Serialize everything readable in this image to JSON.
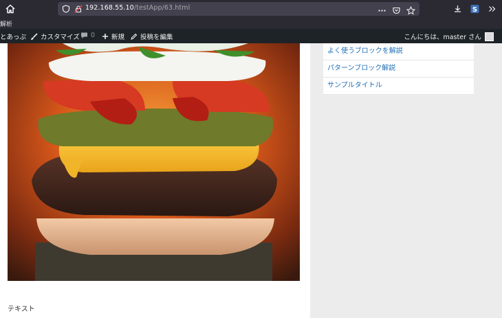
{
  "browser": {
    "url_host": "192.168.55.10",
    "url_path": "/testApp/63.html"
  },
  "bookmarks": {
    "label": "解析"
  },
  "adminbar": {
    "site_label": "とあっぷ",
    "customize_label": "カスタマイズ",
    "comments_count": "0",
    "new_label": "新規",
    "edit_label": "投稿を編集",
    "greeting": "こんにちは、master さん"
  },
  "sidebar": {
    "links": [
      {
        "label": "よく使うブロックを解説"
      },
      {
        "label": "パターンブロック解説"
      },
      {
        "label": "サンプルタイトル"
      }
    ]
  },
  "content": {
    "text": "テキスト",
    "image_alt": "hamburger photo"
  },
  "colors": {
    "browser_chrome": "#2b2a33",
    "adminbar": "#1d2327",
    "link": "#1f6fb5",
    "sidebar_bg": "#ececec"
  }
}
